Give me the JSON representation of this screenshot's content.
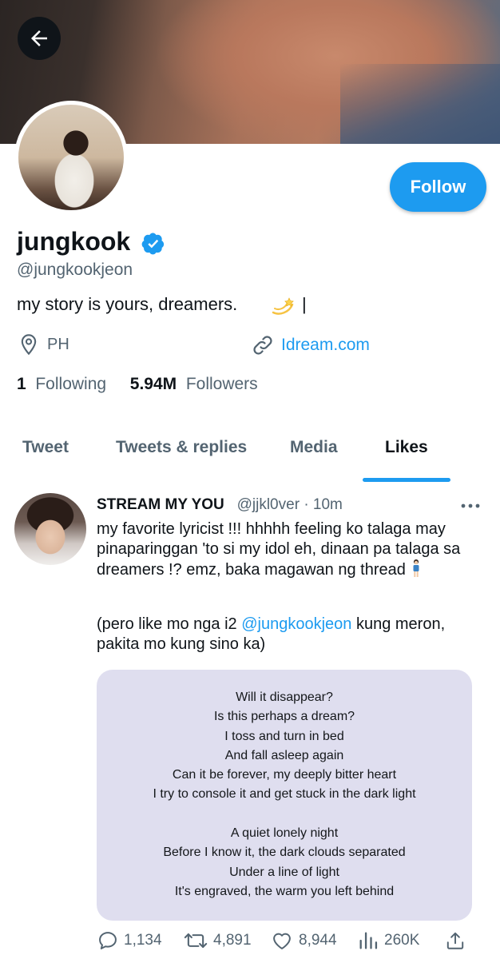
{
  "profile": {
    "display_name": "jungkook",
    "handle": "@jungkookjeon",
    "bio": "my story is yours, dreamers.",
    "bio_cursor": "|",
    "location": "PH",
    "website": "Idream.com",
    "following_count": "1",
    "following_label": "Following",
    "followers_count": "5.94M",
    "followers_label": "Followers",
    "follow_label": "Follow"
  },
  "tabs": [
    {
      "label": "Tweet"
    },
    {
      "label": "Tweets & replies"
    },
    {
      "label": "Media"
    },
    {
      "label": "Likes",
      "active": true
    }
  ],
  "tweet": {
    "author_name": "STREAM MY YOU",
    "author_handle": "@jjkl0ver",
    "separator": "·",
    "time": "10m",
    "text_line1": "my favorite lyricist !!! hhhhh  feeling ko talaga may",
    "text_line2": "pinaparinggan 'to si my idol eh, dinaan pa talaga sa",
    "text_line3": "dreamers !? emz, baka  magawan ng thread",
    "text2_prefix": "(pero like mo nga i2 ",
    "text2_mention": "@jungkookjeon",
    "text2_suffix": " kung meron,",
    "text2_line2": "pakita mo kung sino ka)",
    "lyrics": [
      "Will it disappear?",
      "Is this perhaps a dream?",
      "I toss and turn in bed",
      "And fall asleep again",
      "Can it be forever, my deeply bitter heart",
      "I try to console it and get stuck in the dark light",
      "",
      "A quiet lonely night",
      "Before I know it, the dark clouds separated",
      "Under a line of light",
      "It's engraved, the warm you left behind"
    ],
    "replies": "1,134",
    "retweets": "4,891",
    "likes": "8,944",
    "views": "260K"
  },
  "colors": {
    "accent": "#1d9bf0",
    "text_primary": "#0f1419",
    "text_secondary": "#536471",
    "card_bg": "#dfdeef"
  }
}
